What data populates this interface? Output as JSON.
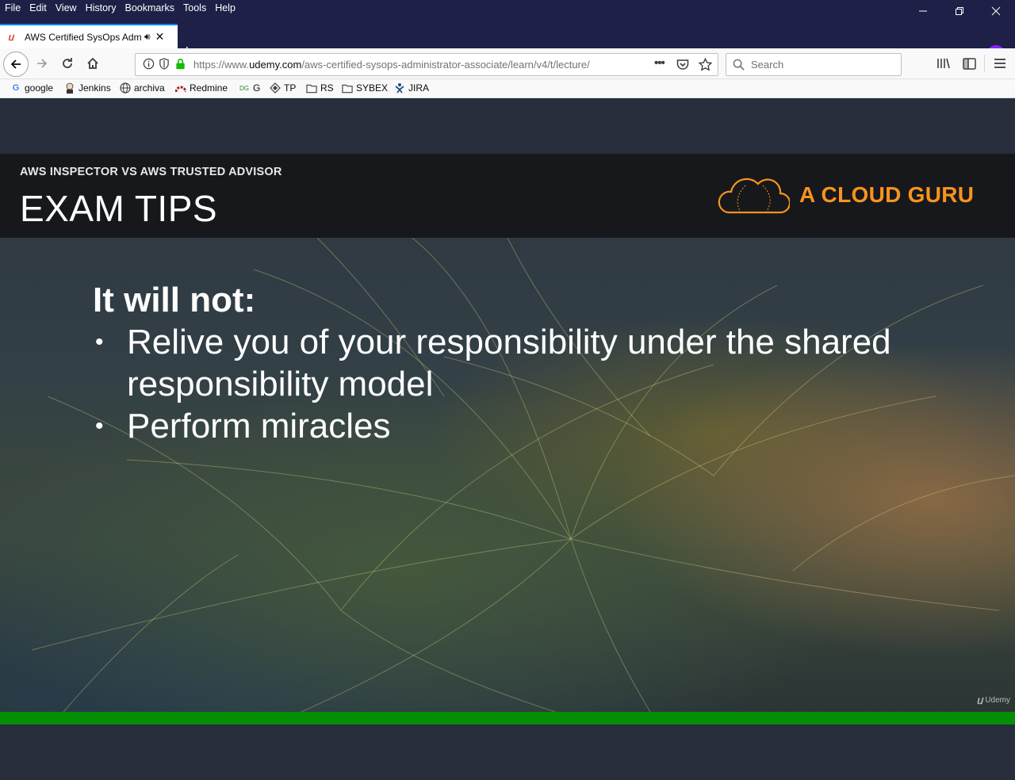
{
  "menu": [
    "File",
    "Edit",
    "View",
    "History",
    "Bookmarks",
    "Tools",
    "Help"
  ],
  "tab": {
    "title": "AWS Certified SysOps Admi",
    "favicon": "udemy-icon"
  },
  "urlbar": {
    "url_prefix": "https://www.",
    "host": "udemy.com",
    "path": "/aws-certified-sysops-administrator-associate/learn/v4/t/lecture/"
  },
  "search": {
    "placeholder": "Search"
  },
  "bookmarks": [
    {
      "label": "google",
      "icon": "google-icon"
    },
    {
      "label": "Jenkins",
      "icon": "jenkins-icon"
    },
    {
      "label": "archiva",
      "icon": "globe-icon"
    },
    {
      "label": "Redmine",
      "icon": "redmine-icon"
    },
    {
      "label": "G",
      "icon": "dg-icon"
    },
    {
      "label": "TP",
      "icon": "tp-icon"
    },
    {
      "label": "RS",
      "icon": "folder-icon"
    },
    {
      "label": "SYBEX",
      "icon": "folder-icon"
    },
    {
      "label": "JIRA",
      "icon": "jira-icon"
    }
  ],
  "slide": {
    "subheading": "AWS INSPECTOR VS AWS TRUSTED ADVISOR",
    "title": "EXAM TIPS",
    "brand": "A CLOUD GURU",
    "lead": "It will not:",
    "bullets": [
      "Relive you of your responsibility under the shared",
      "responsibility model",
      "Perform miracles"
    ],
    "watermark": "Udemy"
  },
  "progress": {
    "fraction": 1.0
  },
  "colors": {
    "chrome_dark": "#1e2047",
    "brand_orange": "#f7931e",
    "progress_green": "#048e04",
    "private_purple": "#8f1fff"
  }
}
